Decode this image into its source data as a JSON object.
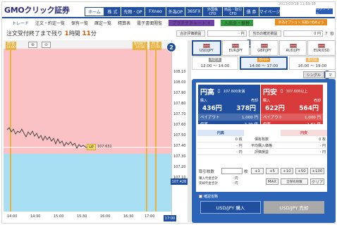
{
  "header": {
    "logo": "GMOクリック証券",
    "ticker": "2013/03/18 11:59:38",
    "nav": [
      {
        "label": "ホーム",
        "active": true
      },
      {
        "label": "株 式"
      },
      {
        "label": "先物・OP"
      },
      {
        "label": "FXneo"
      },
      {
        "label": "外為OP"
      },
      {
        "label": "365FX"
      },
      {
        "label": "外国株",
        "sub": "CFD"
      },
      {
        "label": "商品・取引",
        "sub": "CFD"
      },
      {
        "label": "債 券"
      },
      {
        "label": "マイページ"
      }
    ],
    "logout": "ログアウト"
  },
  "subnav": {
    "items": [
      "トレード",
      "注文・約定一覧",
      "保有一覧",
      "確定一覧",
      "精算表",
      "電子書面閲覧"
    ],
    "platinum": "プラチナチャート +",
    "deposit": "入出金・振替",
    "help": "外為オプション 気軽に始めよう"
  },
  "status": {
    "order_end_label": "注文受付終了まで残り",
    "hours": "1",
    "hours_unit": "時間",
    "minutes": "11",
    "minutes_unit": "分"
  },
  "eval": {
    "label": "合計評価損益",
    "value": "- 円",
    "label2": "当日の確定損益",
    "value2": "0 円"
  },
  "chart": {
    "zoom_in": "+",
    "zoom_out": "-",
    "markers": [
      {
        "label": "開 始",
        "time": "14:00"
      },
      {
        "label": "受付終了",
        "time": "16:58"
      },
      {
        "label": "判 定",
        "time": "17:00"
      }
    ],
    "strike_label": "107.631",
    "current_price": "107.426",
    "time_badge": "17:00",
    "y_ticks": [
      "108.10",
      "108.00",
      "107.90",
      "107.80",
      "107.70",
      "107.60",
      "107.50",
      "107.40",
      "107.30",
      "107.20",
      "107.10"
    ],
    "x_ticks": [
      "14:00",
      "14:30",
      "15:00",
      "15:30",
      "16:00",
      "16:30",
      "17:00"
    ]
  },
  "callouts": [
    "1",
    "2",
    "3",
    "4"
  ],
  "pairs": [
    {
      "code": "USD/JPY",
      "selected": true
    },
    {
      "code": "EUR/JPY"
    },
    {
      "code": "GBP/JPY"
    },
    {
      "code": "AUD/JPY"
    },
    {
      "code": "EUR/USD"
    }
  ],
  "sessions": [
    {
      "tag": "判定済",
      "range": "12:00 ～ 14:00"
    },
    {
      "tag": "受付中",
      "range": "14:00 ～ 17:00",
      "selected": true
    },
    {
      "tag": "受付前",
      "range": "16:00 ～ 19:00"
    }
  ],
  "tabs": [
    "シングル",
    "マ"
  ],
  "quotes": {
    "high": {
      "title": "円高",
      "strike": "107.600未満",
      "buy_label": "購入",
      "buy_price": "436円",
      "sell_label": "売却",
      "sell_price": "378円",
      "payout_label": "ペイアウト",
      "payout": "1,000 円",
      "ratio_label": "倍率",
      "ratio": "2.29 倍"
    },
    "low": {
      "title": "円安",
      "strike": "107.600以上",
      "buy_label": "購入",
      "buy_price": "622円",
      "sell_label": "売却",
      "sell_price": "564円",
      "payout_label": "ペイアウト",
      "payout": "1,000 円",
      "ratio_label": "倍率",
      "ratio": "1.61 倍"
    }
  },
  "positions": {
    "left_head": "円高",
    "right_head": "円安",
    "rows": [
      {
        "left": "0 枚",
        "label": "保有枚数",
        "right": "0 枚"
      },
      {
        "left": "- 円",
        "label": "平均購入価格",
        "right": "- 円"
      },
      {
        "left": "- 円",
        "label": "評価損益",
        "right": "- 円"
      }
    ]
  },
  "trade": {
    "qty_label": "取引枚数",
    "qty_unit": "枚",
    "inc": [
      "+1",
      "+5",
      "+10",
      "+50",
      "+100"
    ],
    "max": "MAX",
    "all": "全保有枚数",
    "clear": "クリア",
    "total_buy": "購入代金合計",
    "total_buy_val": "- 円",
    "total_sell": "売却代金合計",
    "total_sell_val": "- 円",
    "confirm": "確認省略",
    "buy_btn": "USD/JPY 購入",
    "sell_btn": "USD/JPY 売却"
  },
  "colors": {
    "brand": "#1f4f9e",
    "high": "#1f4f9e",
    "low": "#d83a3a",
    "above_zone": "#fbc2c5",
    "below_zone": "#a9dff3",
    "marker": "#e8b340"
  }
}
